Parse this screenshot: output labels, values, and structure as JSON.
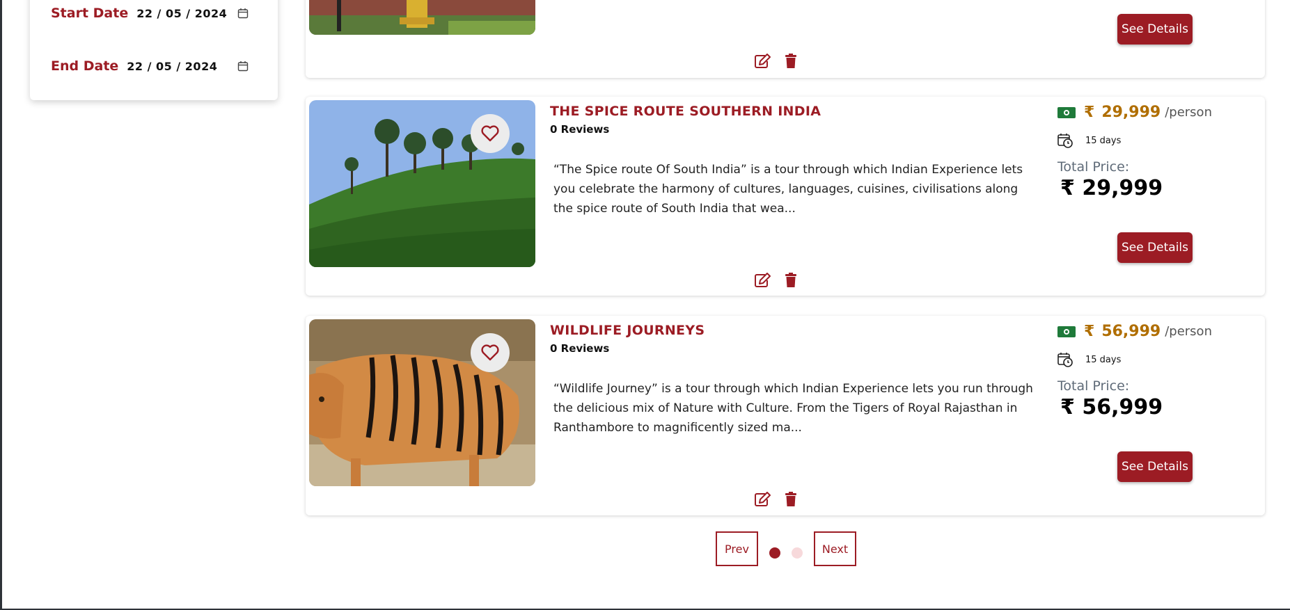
{
  "filters": {
    "start_label": "Start Date",
    "start_value": "22 / 05 / 2024",
    "end_label": "End Date",
    "end_value": "22 / 05 / 2024"
  },
  "top_card": {
    "see_details": "See Details"
  },
  "packages": [
    {
      "title": "THE SPICE ROUTE SOUTHERN INDIA",
      "reviews": "0 Reviews",
      "description": "“The Spice route Of South India” is a tour through which Indian Experience lets you celebrate the harmony of cultures, languages, cuisines, civilisations along the spice route of South India that wea...",
      "currency": "₹",
      "price": "29,999",
      "per": "/person",
      "days": "15 days",
      "total_label": "Total Price:",
      "total_value": "₹ 29,999",
      "see_details": "See Details"
    },
    {
      "title": "WILDLIFE JOURNEYS",
      "reviews": "0 Reviews",
      "description": "“Wildlife Journey” is a tour through which Indian Experience lets you run through the delicious mix of Nature with Culture. From the Tigers of Royal Rajasthan in Ranthambore to magnificently sized ma...",
      "currency": "₹",
      "price": "56,999",
      "per": "/person",
      "days": "15 days",
      "total_label": "Total Price:",
      "total_value": "₹ 56,999",
      "see_details": "See Details"
    }
  ],
  "pagination": {
    "prev": "Prev",
    "next": "Next",
    "current_page": 1,
    "total_pages": 2
  },
  "colors": {
    "brand": "#9c1c24",
    "price": "#b06e00",
    "money_icon": "#1f7a3a",
    "inactive_dot": "#f7d9db"
  }
}
